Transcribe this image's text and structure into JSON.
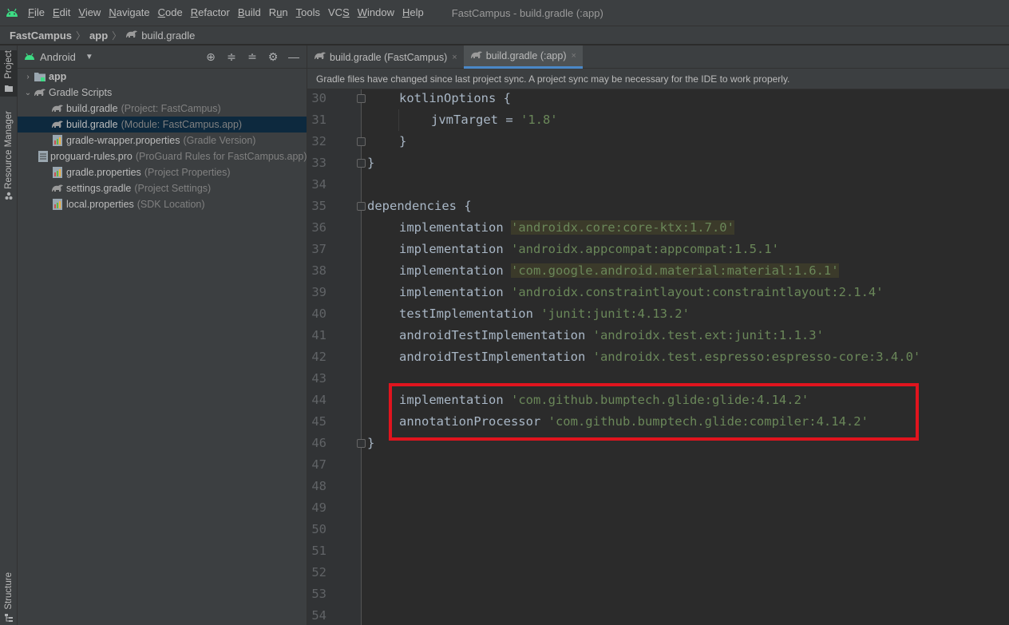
{
  "menubar": {
    "items": [
      {
        "pre": "",
        "mn": "F",
        "post": "ile"
      },
      {
        "pre": "",
        "mn": "E",
        "post": "dit"
      },
      {
        "pre": "",
        "mn": "V",
        "post": "iew"
      },
      {
        "pre": "",
        "mn": "N",
        "post": "avigate"
      },
      {
        "pre": "",
        "mn": "C",
        "post": "ode"
      },
      {
        "pre": "",
        "mn": "R",
        "post": "efactor"
      },
      {
        "pre": "",
        "mn": "B",
        "post": "uild"
      },
      {
        "pre": "R",
        "mn": "u",
        "post": "n"
      },
      {
        "pre": "",
        "mn": "T",
        "post": "ools"
      },
      {
        "pre": "VC",
        "mn": "S",
        "post": ""
      },
      {
        "pre": "",
        "mn": "W",
        "post": "indow"
      },
      {
        "pre": "",
        "mn": "H",
        "post": "elp"
      }
    ],
    "window_title": "FastCampus - build.gradle (:app)"
  },
  "breadcrumb": {
    "project": "FastCampus",
    "module": "app",
    "file": "build.gradle"
  },
  "toolstrip": {
    "project_tab": "Project",
    "resource_tab": "Resource Manager",
    "structure_tab": "Structure"
  },
  "project_panel": {
    "view": "Android",
    "tree": [
      {
        "label": "app",
        "hint": "",
        "icon": "folder-icon",
        "indent": 0,
        "arrow": "›",
        "selected": false,
        "bold": true
      },
      {
        "label": "Gradle Scripts",
        "hint": "",
        "icon": "gradle-icon",
        "indent": 0,
        "arrow": "⌄",
        "selected": false,
        "bold": false
      },
      {
        "label": "build.gradle",
        "hint": "(Project: FastCampus)",
        "icon": "gradle-icon",
        "indent": 1,
        "arrow": "",
        "selected": false,
        "bold": false
      },
      {
        "label": "build.gradle",
        "hint": "(Module: FastCampus.app)",
        "icon": "gradle-icon",
        "indent": 1,
        "arrow": "",
        "selected": true,
        "bold": false
      },
      {
        "label": "gradle-wrapper.properties",
        "hint": "(Gradle Version)",
        "icon": "properties-icon",
        "indent": 1,
        "arrow": "",
        "selected": false,
        "bold": false
      },
      {
        "label": "proguard-rules.pro",
        "hint": "(ProGuard Rules for FastCampus.app)",
        "icon": "text-file-icon",
        "indent": 1,
        "arrow": "",
        "selected": false,
        "bold": false
      },
      {
        "label": "gradle.properties",
        "hint": "(Project Properties)",
        "icon": "properties-icon",
        "indent": 1,
        "arrow": "",
        "selected": false,
        "bold": false
      },
      {
        "label": "settings.gradle",
        "hint": "(Project Settings)",
        "icon": "gradle-icon",
        "indent": 1,
        "arrow": "",
        "selected": false,
        "bold": false
      },
      {
        "label": "local.properties",
        "hint": "(SDK Location)",
        "icon": "properties-icon",
        "indent": 1,
        "arrow": "",
        "selected": false,
        "bold": false
      }
    ]
  },
  "editor_tabs": [
    {
      "label": "build.gradle (FastCampus)",
      "active": false
    },
    {
      "label": "build.gradle (:app)",
      "active": true
    }
  ],
  "notification": "Gradle files have changed since last project sync. A project sync may be necessary for the IDE to work properly.",
  "code_lines": [
    {
      "n": "30",
      "indent": 1,
      "parts": [
        {
          "t": "kotlinOptions {",
          "c": ""
        }
      ]
    },
    {
      "n": "31",
      "indent": 2,
      "parts": [
        {
          "t": "jvmTarget = ",
          "c": ""
        },
        {
          "t": "'1.8'",
          "c": "str"
        }
      ]
    },
    {
      "n": "32",
      "indent": 1,
      "parts": [
        {
          "t": "}",
          "c": ""
        }
      ]
    },
    {
      "n": "33",
      "indent": 0,
      "parts": [
        {
          "t": "}",
          "c": ""
        }
      ]
    },
    {
      "n": "34",
      "indent": 0,
      "parts": []
    },
    {
      "n": "35",
      "indent": 0,
      "parts": [
        {
          "t": "dependencies {",
          "c": ""
        }
      ]
    },
    {
      "n": "36",
      "indent": 1,
      "parts": [
        {
          "t": "implementation ",
          "c": ""
        },
        {
          "t": "'androidx.core:core-ktx:1.7.0'",
          "c": "str hl"
        }
      ]
    },
    {
      "n": "37",
      "indent": 1,
      "parts": [
        {
          "t": "implementation ",
          "c": ""
        },
        {
          "t": "'androidx.appcompat:appcompat:1.5.1'",
          "c": "str"
        }
      ]
    },
    {
      "n": "38",
      "indent": 1,
      "parts": [
        {
          "t": "implementation ",
          "c": ""
        },
        {
          "t": "'com.google.android.material:material:1.6.1'",
          "c": "str hl"
        }
      ]
    },
    {
      "n": "39",
      "indent": 1,
      "parts": [
        {
          "t": "implementation ",
          "c": ""
        },
        {
          "t": "'androidx.constraintlayout:constraintlayout:2.1.4'",
          "c": "str"
        }
      ]
    },
    {
      "n": "40",
      "indent": 1,
      "parts": [
        {
          "t": "testImplementation ",
          "c": ""
        },
        {
          "t": "'junit:junit:4.13.2'",
          "c": "str"
        }
      ]
    },
    {
      "n": "41",
      "indent": 1,
      "parts": [
        {
          "t": "androidTestImplementation ",
          "c": ""
        },
        {
          "t": "'androidx.test.ext:junit:1.1.3'",
          "c": "str"
        }
      ]
    },
    {
      "n": "42",
      "indent": 1,
      "parts": [
        {
          "t": "androidTestImplementation ",
          "c": ""
        },
        {
          "t": "'androidx.test.espresso:espresso-core:3.4.0'",
          "c": "str"
        }
      ]
    },
    {
      "n": "43",
      "indent": 0,
      "parts": []
    },
    {
      "n": "44",
      "indent": 1,
      "parts": [
        {
          "t": "implementation ",
          "c": ""
        },
        {
          "t": "'com.github.bumptech.glide:glide:4.14.2'",
          "c": "str"
        }
      ]
    },
    {
      "n": "45",
      "indent": 1,
      "parts": [
        {
          "t": "annotationProcessor ",
          "c": ""
        },
        {
          "t": "'com.github.bumptech.glide:compiler:4.14.2'",
          "c": "str"
        }
      ]
    },
    {
      "n": "46",
      "indent": 0,
      "parts": [
        {
          "t": "}",
          "c": ""
        }
      ]
    },
    {
      "n": "47",
      "indent": 0,
      "parts": []
    },
    {
      "n": "48",
      "indent": 0,
      "parts": []
    },
    {
      "n": "49",
      "indent": 0,
      "parts": []
    },
    {
      "n": "50",
      "indent": 0,
      "parts": []
    },
    {
      "n": "51",
      "indent": 0,
      "parts": []
    },
    {
      "n": "52",
      "indent": 0,
      "parts": []
    },
    {
      "n": "53",
      "indent": 0,
      "parts": []
    },
    {
      "n": "54",
      "indent": 0,
      "parts": []
    }
  ],
  "colors": {
    "editor_bg": "#2b2b2b",
    "string": "#6a8759",
    "code_text": "#a9b7c6",
    "highlight_box": "#e0141e",
    "selection": "#0d293e",
    "active_tab_underline": "#4a88c7"
  }
}
